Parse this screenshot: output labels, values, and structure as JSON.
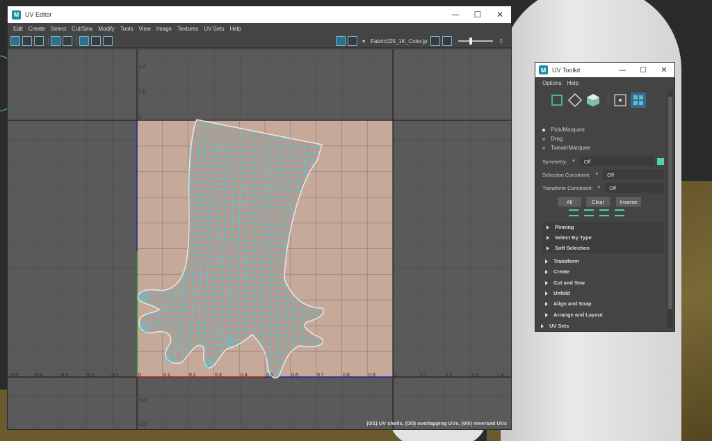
{
  "uv_editor": {
    "title": "UV Editor",
    "menus": [
      "Edit",
      "Create",
      "Select",
      "Cut/Sew",
      "Modify",
      "Tools",
      "View",
      "Image",
      "Textures",
      "UV Sets",
      "Help"
    ],
    "texture_name": "Fabric025_1K_Color.jp",
    "status": "(0/1) UV shells, (0/0) overlapping UVs, (0/0) reversed UVs",
    "axis_labels_top": [
      "1.2",
      "1.1",
      "1"
    ],
    "axis_labels_bottom": [
      "-0.5",
      "-0.4",
      "-0.3",
      "-0.2",
      "-0.1",
      "0",
      "0.1",
      "0.2",
      "0.3",
      "0.4",
      "0.5",
      "0.6",
      "0.7",
      "0.8",
      "0.9",
      "1",
      "1.1",
      "1.2",
      "1.3",
      "1.4"
    ],
    "axis_labels_below": [
      "-0.1",
      "-0.2"
    ]
  },
  "uv_toolkit": {
    "title": "UV Toolkit",
    "menus": [
      "Options",
      "Help"
    ],
    "modes": [
      {
        "label": "Pick/Marquee",
        "selected": true
      },
      {
        "label": "Drag",
        "selected": false
      },
      {
        "label": "Tweak/Marquee",
        "selected": false
      }
    ],
    "symmetry": {
      "label": "Symmetry:",
      "value": "Off"
    },
    "selection_constraint": {
      "label": "Selection Constraint:",
      "value": "Off"
    },
    "transform_constraint": {
      "label": "Transform Constraint:",
      "value": "Off"
    },
    "buttons": [
      "All",
      "Clear",
      "Inverse"
    ],
    "sub_sections": [
      "Pinning",
      "Select By Type",
      "Soft Selection"
    ],
    "sections": [
      "Transform",
      "Create",
      "Cut and Sew",
      "Unfold",
      "Align and Snap",
      "Arrange and Layout"
    ],
    "bottom_section": "UV Sets"
  },
  "window_controls": {
    "minimize": "—",
    "maximize": "☐",
    "close": "✕"
  },
  "colors": {
    "accent": "#4fd0e0",
    "uv_tile": "#c9a99b",
    "mesh": "#3fd4e0"
  }
}
